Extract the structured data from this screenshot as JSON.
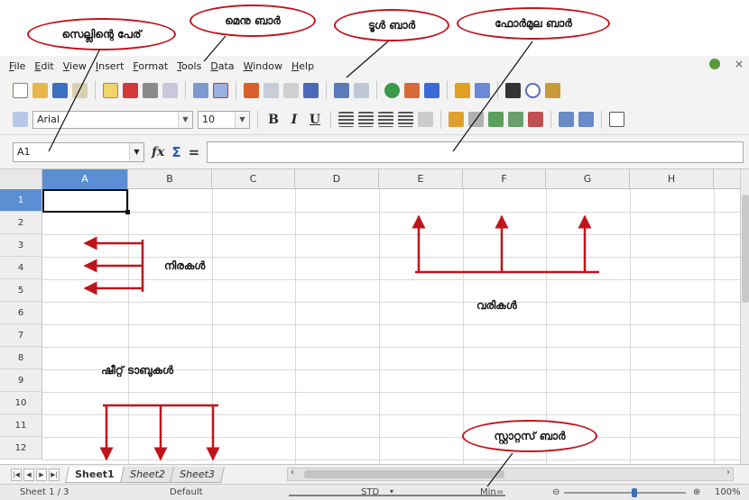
{
  "callouts": {
    "cell_name": "സെല്ലിന്റെ പേര്",
    "menu_bar": "മെനു ബാർ",
    "tool_bar": "ടൂൾ ബാർ",
    "formula_bar": "ഫോർമുല ബാർ",
    "status_bar": "സ്റ്റാറ്റസ് ബാർ"
  },
  "annotations": {
    "rows": "നിരകൾ",
    "columns": "വരികൾ",
    "sheet_tabs": "ഷീറ്റ് ടാബുകൾ"
  },
  "menubar": {
    "items": [
      "File",
      "Edit",
      "View",
      "Insert",
      "Format",
      "Tools",
      "Data",
      "Window",
      "Help"
    ]
  },
  "toolbar": {
    "font_name": "Arial",
    "font_size": "10",
    "bold_label": "B",
    "italic_label": "I",
    "underline_label": "U"
  },
  "formula_bar": {
    "name_box": "A1",
    "fx_label": "fx",
    "sum_label": "Σ",
    "equals_label": "="
  },
  "grid": {
    "columns": [
      "A",
      "B",
      "C",
      "D",
      "E",
      "F",
      "G",
      "H"
    ],
    "rows": [
      "1",
      "2",
      "3",
      "4",
      "5",
      "6",
      "7",
      "8",
      "9",
      "10",
      "11",
      "12"
    ],
    "active_cell": "A1"
  },
  "sheets": {
    "tabs": [
      "Sheet1",
      "Sheet2",
      "Sheet3"
    ],
    "active": "Sheet1"
  },
  "statusbar": {
    "sheet_info": "Sheet 1 / 3",
    "page_style": "Default",
    "selection_mode": "STD",
    "sum_info": "Min=",
    "zoom": "100%"
  },
  "colors": {
    "callout_border": "#c0141c",
    "annotation_arrow": "#c0141c",
    "selection_header": "#5b8fd4"
  }
}
